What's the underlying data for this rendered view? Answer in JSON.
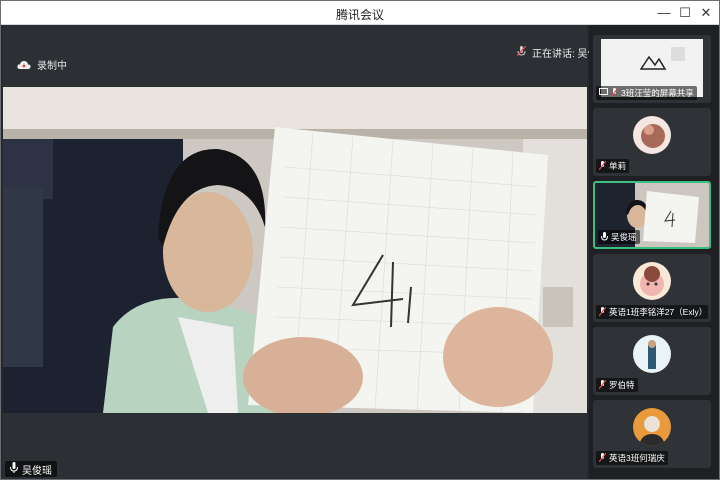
{
  "window": {
    "title": "腾讯会议"
  },
  "controls": {
    "minimize": "—",
    "maximize": "☐",
    "close": "✕"
  },
  "meeting": {
    "recording_label": "录制中",
    "speaking_label": "正在讲话: 吴俊瑶;",
    "main_speaker": "吴俊瑶",
    "paper_text": "4"
  },
  "participants": [
    {
      "name": "3班汪莹的屏幕共享"
    },
    {
      "name": "单莉"
    },
    {
      "name": "吴俊瑶"
    },
    {
      "name": "英语1班李铭洋27（Exly）"
    },
    {
      "name": "罗伯特"
    },
    {
      "name": "英语3班何瑞庆"
    }
  ],
  "colors": {
    "active_border": "#3fbf7f",
    "mic_muted": "#e04848"
  }
}
